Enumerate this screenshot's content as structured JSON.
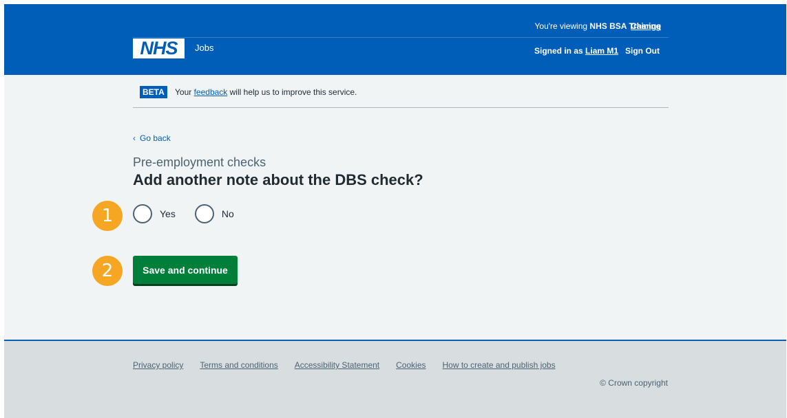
{
  "header": {
    "viewing_prefix": "You're viewing",
    "viewing_org": "NHS BSA Training",
    "change_label": "Change",
    "logo_text": "NHS",
    "service_name": "Jobs",
    "signed_in_prefix": "Signed in as",
    "user_name": "Liam M1",
    "sign_out_label": "Sign Out"
  },
  "beta_banner": {
    "tag": "BETA",
    "text_before": "Your",
    "link_text": "feedback",
    "text_after": "will help us to improve this service."
  },
  "back_link": "Go back",
  "caption": "Pre-employment checks",
  "heading": "Add another note about the DBS check?",
  "radios": {
    "yes_label": "Yes",
    "no_label": "No"
  },
  "save_button": "Save and continue",
  "steps": {
    "step_1": "1",
    "step_2": "2"
  },
  "footer": {
    "links": [
      "Privacy policy",
      "Terms and conditions",
      "Accessibility Statement",
      "Cookies",
      "How to create and publish jobs"
    ],
    "copyright": "© Crown copyright"
  },
  "colors": {
    "nhs_blue": "#005eb8",
    "button_green": "#007f3b",
    "step_marker": "#f5a623",
    "page_background": "#f0f4f5",
    "footer_background": "#d8dde0"
  }
}
